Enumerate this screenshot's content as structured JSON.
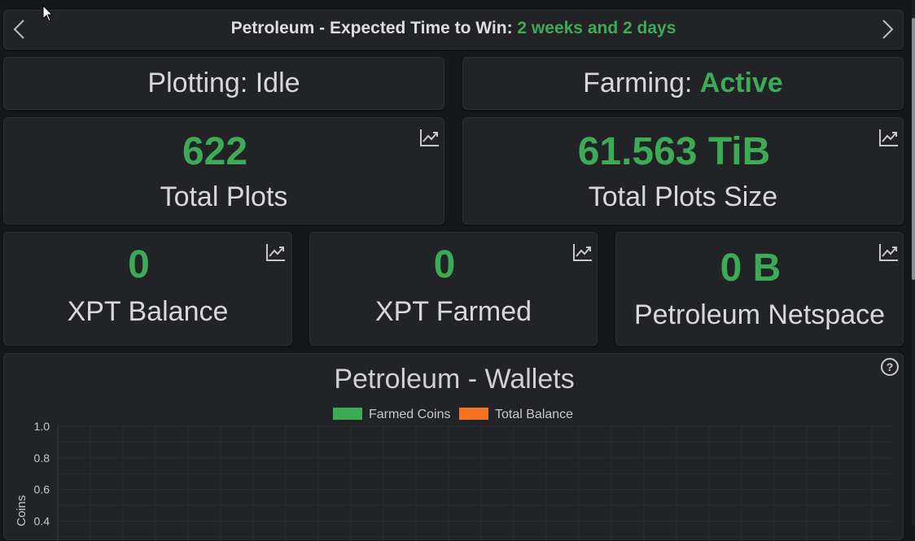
{
  "banner": {
    "prefix": "Petroleum - Expected Time to Win: ",
    "time": "2 weeks and 2 days"
  },
  "plotting": {
    "label": "Plotting: ",
    "status": "Idle"
  },
  "farming": {
    "label": "Farming: ",
    "status": "Active"
  },
  "stats": {
    "total_plots": {
      "value": "622",
      "label": "Total Plots"
    },
    "total_plots_size": {
      "value": "61.563 TiB",
      "label": "Total Plots Size"
    },
    "xpt_balance": {
      "value": "0",
      "label": "XPT Balance"
    },
    "xpt_farmed": {
      "value": "0",
      "label": "XPT Farmed"
    },
    "netspace": {
      "value": "0 B",
      "label": "Petroleum Netspace"
    }
  },
  "wallets_chart": {
    "title": "Petroleum - Wallets",
    "legend": [
      {
        "name": "Farmed Coins",
        "color": "#3daa56"
      },
      {
        "name": "Total Balance",
        "color": "#f47322"
      }
    ],
    "ylabel": "Coins"
  },
  "chart_data": {
    "type": "line",
    "title": "Petroleum - Wallets",
    "xlabel": "",
    "ylabel": "Coins",
    "ylim": [
      0,
      1.0
    ],
    "y_ticks": [
      "1.0",
      "0.8",
      "0.6",
      "0.4"
    ],
    "grid": true,
    "legend_placement": "top",
    "series": [
      {
        "name": "Farmed Coins",
        "color": "#3daa56",
        "values": []
      },
      {
        "name": "Total Balance",
        "color": "#f47322",
        "values": []
      }
    ]
  },
  "colors": {
    "accent_green": "#3daa56",
    "card_bg": "#212326",
    "page_bg": "#15171a"
  }
}
